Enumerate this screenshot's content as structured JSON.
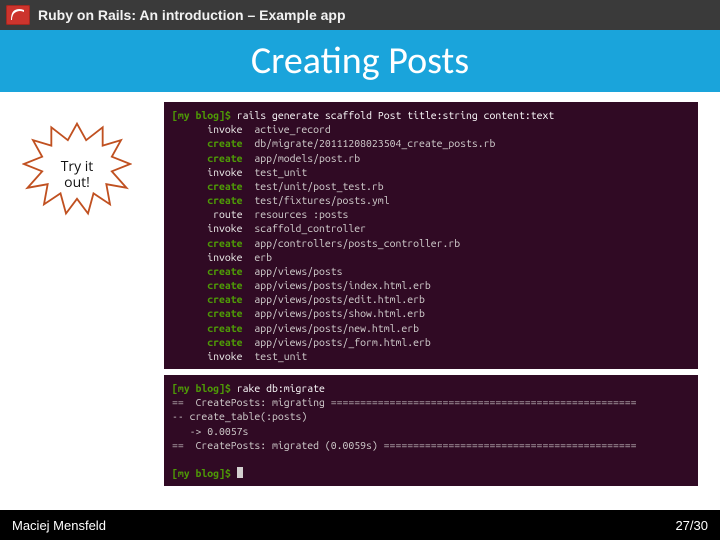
{
  "topbar": {
    "title": "Ruby on Rails: An introduction – Example app"
  },
  "titleband": {
    "heading": "Creating Posts"
  },
  "callout": {
    "line1": "Try it",
    "line2": "out!"
  },
  "terminal1": {
    "prompt_user": "[my blog]$",
    "prompt_cmd": "rails generate scaffold Post title:string content:text",
    "lines": [
      {
        "tag": "invoke",
        "path": "active_record"
      },
      {
        "tag": "create",
        "path": "db/migrate/20111208023504_create_posts.rb"
      },
      {
        "tag": "create",
        "path": "app/models/post.rb"
      },
      {
        "tag": "invoke",
        "path": "test_unit"
      },
      {
        "tag": "create",
        "path": "test/unit/post_test.rb"
      },
      {
        "tag": "create",
        "path": "test/fixtures/posts.yml"
      },
      {
        "tag": "route",
        "path": "resources :posts"
      },
      {
        "tag": "invoke",
        "path": "scaffold_controller"
      },
      {
        "tag": "create",
        "path": "app/controllers/posts_controller.rb"
      },
      {
        "tag": "invoke",
        "path": "erb"
      },
      {
        "tag": "create",
        "path": "app/views/posts"
      },
      {
        "tag": "create",
        "path": "app/views/posts/index.html.erb"
      },
      {
        "tag": "create",
        "path": "app/views/posts/edit.html.erb"
      },
      {
        "tag": "create",
        "path": "app/views/posts/show.html.erb"
      },
      {
        "tag": "create",
        "path": "app/views/posts/new.html.erb"
      },
      {
        "tag": "create",
        "path": "app/views/posts/_form.html.erb"
      },
      {
        "tag": "invoke",
        "path": "test_unit"
      }
    ]
  },
  "terminal2": {
    "prompt_user": "[my blog]$",
    "prompt_cmd": "rake db:migrate",
    "out1": "==  CreatePosts: migrating ====================================================",
    "out2": "-- create_table(:posts)",
    "out3": "   -> 0.0057s",
    "out4": "==  CreatePosts: migrated (0.0059s) ===========================================",
    "prompt2_user": "[my blog]$"
  },
  "footer": {
    "author": "Maciej Mensfeld",
    "page": "27/30"
  }
}
